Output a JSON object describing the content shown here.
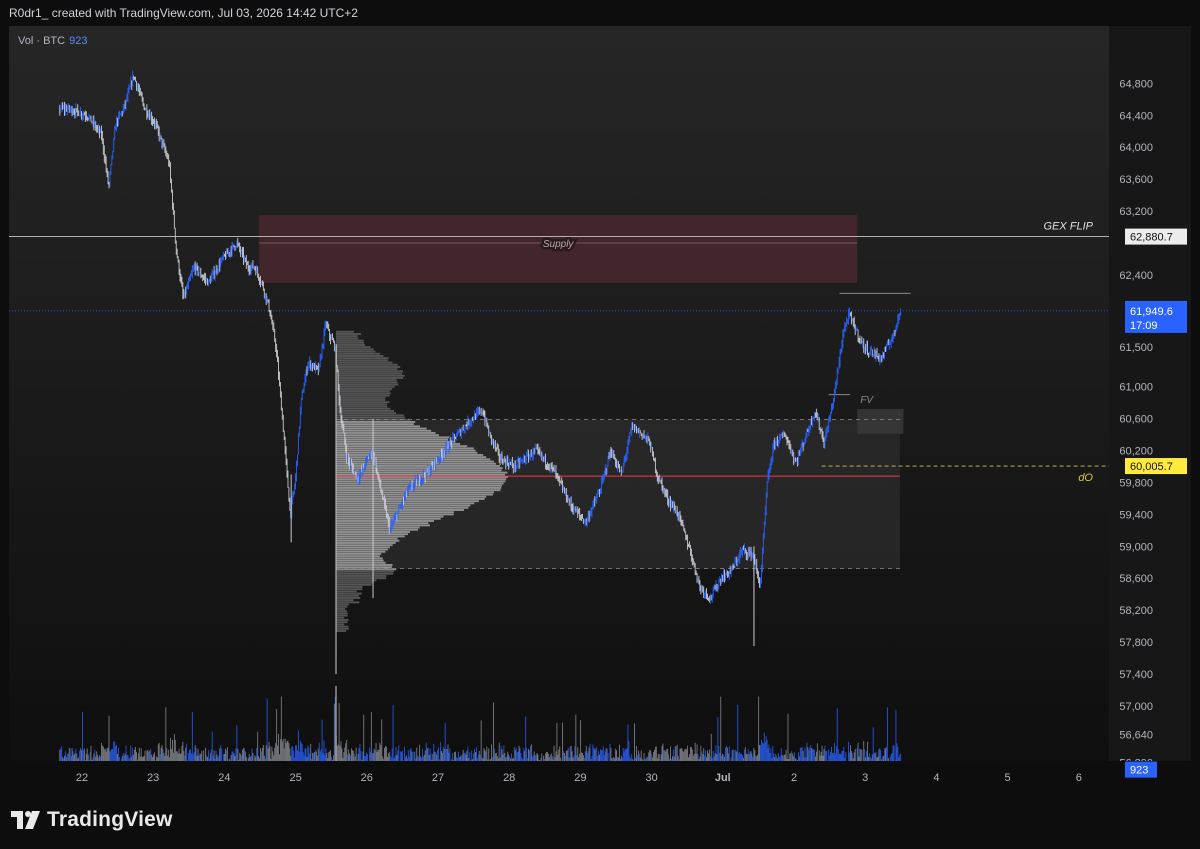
{
  "header": {
    "title": "R0dr1_ created with TradingView.com, Jul 03, 2026 14:42 UTC+2"
  },
  "volume_legend": {
    "label": "Vol · BTC",
    "value": "923"
  },
  "brand": {
    "name": "TradingView"
  },
  "colors": {
    "background_top": "#262626",
    "background_bottom": "#0e0e0e",
    "candle_up": "#2962ff",
    "candle_down": "#c9ccd3",
    "supply_zone": "#5c2a36",
    "price_label": "#2962ff",
    "d0_label": "#ffeb3b",
    "poc_line": "#f23645"
  },
  "chart_data": {
    "type": "candlestick",
    "symbol": "BTC",
    "x_labels": [
      "22",
      "23",
      "24",
      "25",
      "26",
      "27",
      "28",
      "29",
      "30",
      "Jul",
      "2",
      "3",
      "4",
      "5",
      "6"
    ],
    "y_ticks": [
      64800,
      64400,
      64000,
      63600,
      63200,
      62400,
      61500,
      61000,
      60600,
      60200,
      59800,
      59400,
      59000,
      58600,
      58200,
      57800,
      57400,
      57000,
      56640,
      56290
    ],
    "y_range": [
      56100,
      65000
    ],
    "current_price": {
      "value": "61,949.6",
      "countdown": "17:09"
    },
    "levels": [
      {
        "name": "GEX FLIP",
        "value": 62880.7,
        "label": "62,880.7"
      },
      {
        "name": "dO",
        "value": 60005.7,
        "label": "60,005.7"
      }
    ],
    "zones": [
      {
        "name": "Supply",
        "from_day": 24.6,
        "to_day": 33.0,
        "low": 62300,
        "high": 63150
      },
      {
        "name": "FV",
        "from_day": 33.0,
        "to_day": 33.65,
        "low": 60410,
        "high": 60720
      }
    ],
    "volume_profile": {
      "from_day": 25.68,
      "to_day": 33.6,
      "poc": 59880,
      "value_area_high": 60590,
      "value_area_low": 58720
    },
    "price_path": [
      [
        21.95,
        64480
      ],
      [
        22.2,
        64400
      ],
      [
        22.4,
        64150
      ],
      [
        22.5,
        63500
      ],
      [
        22.6,
        64300
      ],
      [
        22.72,
        64500
      ],
      [
        22.85,
        64900
      ],
      [
        23.0,
        64500
      ],
      [
        23.15,
        64300
      ],
      [
        23.35,
        63800
      ],
      [
        23.45,
        62700
      ],
      [
        23.55,
        62100
      ],
      [
        23.7,
        62500
      ],
      [
        23.9,
        62300
      ],
      [
        24.1,
        62600
      ],
      [
        24.3,
        62800
      ],
      [
        24.45,
        62500
      ],
      [
        24.55,
        62500
      ],
      [
        24.65,
        62300
      ],
      [
        24.75,
        62000
      ],
      [
        24.85,
        61500
      ],
      [
        24.95,
        60500
      ],
      [
        25.05,
        59400
      ],
      [
        25.12,
        59800
      ],
      [
        25.2,
        60800
      ],
      [
        25.3,
        61300
      ],
      [
        25.45,
        61200
      ],
      [
        25.55,
        61800
      ],
      [
        25.6,
        61650
      ],
      [
        25.68,
        61500
      ],
      [
        25.75,
        60700
      ],
      [
        25.85,
        60100
      ],
      [
        26.0,
        59850
      ],
      [
        26.2,
        60200
      ],
      [
        26.45,
        59200
      ],
      [
        26.7,
        59700
      ],
      [
        27.0,
        59950
      ],
      [
        27.3,
        60300
      ],
      [
        27.6,
        60600
      ],
      [
        27.75,
        60700
      ],
      [
        27.85,
        60400
      ],
      [
        28.0,
        60100
      ],
      [
        28.2,
        60000
      ],
      [
        28.5,
        60200
      ],
      [
        28.75,
        59950
      ],
      [
        29.0,
        59500
      ],
      [
        29.2,
        59300
      ],
      [
        29.4,
        59700
      ],
      [
        29.55,
        60200
      ],
      [
        29.7,
        59900
      ],
      [
        29.85,
        60500
      ],
      [
        30.0,
        60400
      ],
      [
        30.1,
        60300
      ],
      [
        30.2,
        59900
      ],
      [
        30.35,
        59600
      ],
      [
        30.5,
        59400
      ],
      [
        30.65,
        59000
      ],
      [
        30.8,
        58500
      ],
      [
        30.95,
        58350
      ],
      [
        31.1,
        58600
      ],
      [
        31.25,
        58700
      ],
      [
        31.4,
        58950
      ],
      [
        31.55,
        58900
      ],
      [
        31.65,
        58500
      ],
      [
        31.75,
        59800
      ],
      [
        31.85,
        60300
      ],
      [
        32.0,
        60400
      ],
      [
        32.15,
        60050
      ],
      [
        32.3,
        60400
      ],
      [
        32.42,
        60700
      ],
      [
        32.55,
        60300
      ],
      [
        32.65,
        60700
      ],
      [
        32.75,
        61250
      ],
      [
        32.82,
        61700
      ],
      [
        32.9,
        61900
      ],
      [
        33.1,
        61500
      ],
      [
        33.35,
        61350
      ],
      [
        33.55,
        61700
      ],
      [
        33.6,
        61949.6
      ]
    ]
  }
}
